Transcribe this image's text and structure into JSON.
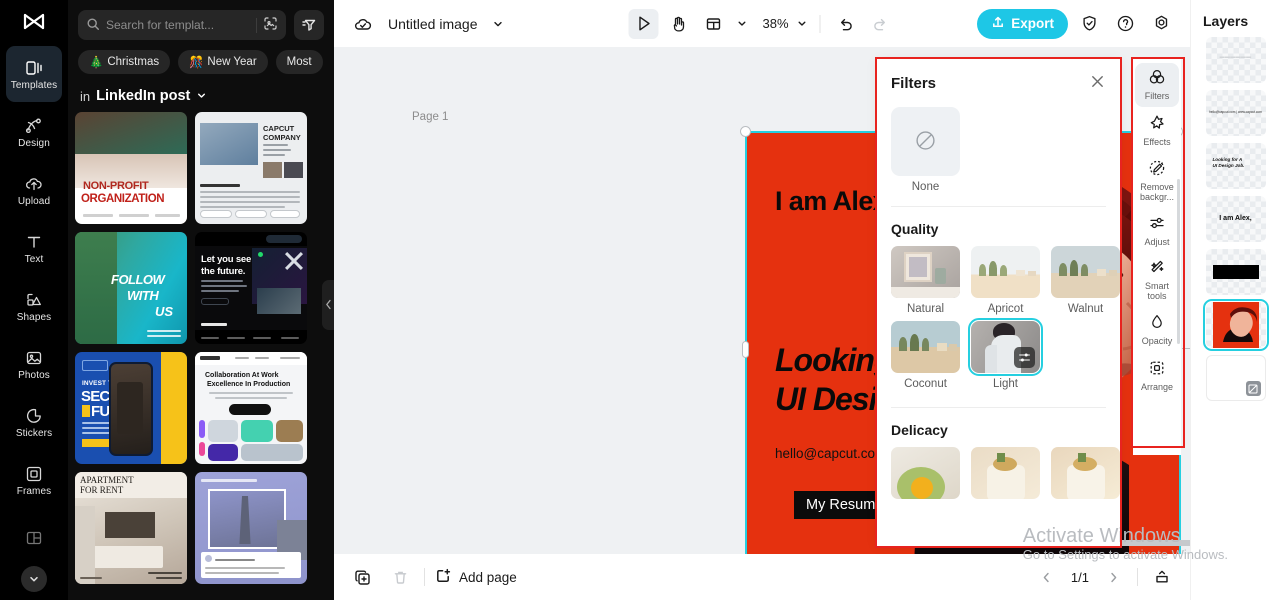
{
  "app": {
    "name": "CapCut",
    "logo_icon": "capcut-logo-icon"
  },
  "left_rail": {
    "items": [
      {
        "label": "Templates",
        "icon": "templates-icon",
        "active": true
      },
      {
        "label": "Design",
        "icon": "design-icon",
        "active": false
      },
      {
        "label": "Upload",
        "icon": "upload-cloud-icon",
        "active": false
      },
      {
        "label": "Text",
        "icon": "text-icon",
        "active": false
      },
      {
        "label": "Shapes",
        "icon": "shapes-icon",
        "active": false
      },
      {
        "label": "Photos",
        "icon": "photos-icon",
        "active": false
      },
      {
        "label": "Stickers",
        "icon": "stickers-icon",
        "active": false
      },
      {
        "label": "Frames",
        "icon": "frames-icon",
        "active": false
      }
    ],
    "more_icon": "chevron-down-icon"
  },
  "template_panel": {
    "search": {
      "placeholder": "Search for templat...",
      "search_icon": "search-icon",
      "image_search_icon": "image-search-icon"
    },
    "filter_icon": "filter-sort-icon",
    "chips": [
      {
        "label": "Christmas",
        "emoji": "🎄"
      },
      {
        "label": "New Year",
        "emoji": "🎊"
      },
      {
        "label": "Most",
        "emoji": ""
      }
    ],
    "category_prefix": "in",
    "category_name": "LinkedIn post",
    "category_caret_icon": "chevron-down-icon",
    "collapse_icon": "chevron-left-icon",
    "templates": [
      {
        "name": "non-profit-organization",
        "title_line1": "NON-PROFIT",
        "title_line2": "ORGANIZATION"
      },
      {
        "name": "capcut-company",
        "title_line1": "CAPCUT",
        "title_line2": "COMPANY"
      },
      {
        "name": "follow-with-us",
        "title_line1": "FOLLOW",
        "title_line2": "WITH",
        "title_line3": "US"
      },
      {
        "name": "let-you-see-the-future",
        "title_line1": "Let you see",
        "title_line2": "the future."
      },
      {
        "name": "secure-future",
        "title_line1": "INVEST TODAY!",
        "title_line2": "SECURE",
        "title_line3": "FUTURE"
      },
      {
        "name": "collaboration-at-work",
        "title_line1": "Collaboration At Work",
        "title_line2": "Excellence In Production"
      },
      {
        "name": "apartment-for-rent",
        "title_line1": "APARTMENT",
        "title_line2": "FOR RENT"
      },
      {
        "name": "travel-post",
        "title_line1": "",
        "title_line2": ""
      }
    ]
  },
  "topbar": {
    "cloud_icon": "cloud-saved-icon",
    "doc_title": "Untitled image",
    "title_caret_icon": "chevron-down-icon",
    "tools": [
      {
        "name": "select-tool",
        "icon": "cursor-arrow-icon",
        "active": true
      },
      {
        "name": "hand-tool",
        "icon": "hand-icon",
        "active": false
      },
      {
        "name": "layout-tool",
        "icon": "layout-icon",
        "active": false
      }
    ],
    "layout_caret_icon": "chevron-down-icon",
    "zoom": "38%",
    "zoom_caret_icon": "chevron-down-icon",
    "undo_icon": "undo-icon",
    "redo_icon": "redo-icon",
    "export_label": "Export",
    "export_icon": "export-upload-icon",
    "export_color": "#1ec7e6",
    "shield_icon": "shield-icon",
    "help_icon": "help-circle-icon",
    "settings_icon": "gear-icon"
  },
  "canvas": {
    "page_label": "Page 1",
    "float_toolbar": [
      {
        "name": "crop-button",
        "icon": "crop-icon"
      },
      {
        "name": "replace-button",
        "icon": "replace-shapes-icon"
      },
      {
        "name": "duplicate-button",
        "icon": "duplicate-icon"
      },
      {
        "name": "more-button",
        "icon": "more-dots-icon"
      }
    ],
    "top_right": [
      {
        "name": "image-layer-button",
        "icon": "image-stack-icon"
      },
      {
        "name": "page-more-button",
        "icon": "more-dots-icon"
      }
    ],
    "rotate_icon": "rotate-icon",
    "artwork": {
      "background_color": "#e5310f",
      "heading": "I am Alex,",
      "subheading_line1": "Looking for A",
      "subheading_line2": "UI Design Job.",
      "contact": "hello@capcut.com | www.capcut.com",
      "button_label": "My Resume"
    }
  },
  "filters_panel": {
    "title": "Filters",
    "close_icon": "close-icon",
    "none": {
      "label": "None",
      "icon": "no-filter-icon"
    },
    "sections": [
      {
        "title": "Quality",
        "items": [
          {
            "label": "Natural",
            "selected": false,
            "c1": "#d9d2cc",
            "c2": "#b9b2ad"
          },
          {
            "label": "Apricot",
            "selected": false,
            "c1": "#eef0f1",
            "c2": "#efdfc7"
          },
          {
            "label": "Walnut",
            "selected": false,
            "c1": "#cfd8da",
            "c2": "#e3d4bd"
          },
          {
            "label": "Coconut",
            "selected": false,
            "c1": "#bcd0d4",
            "c2": "#ddc9ab"
          },
          {
            "label": "Light",
            "selected": true,
            "c1": "#b3b0ad",
            "c2": "#8f8d8c"
          }
        ]
      },
      {
        "title": "Delicacy",
        "items": [
          {
            "label": "",
            "selected": false,
            "c1": "#eceae4",
            "c2": "#f0c53a"
          },
          {
            "label": "",
            "selected": false,
            "c1": "#ead9c4",
            "c2": "#f3e7cf"
          },
          {
            "label": "",
            "selected": false,
            "c1": "#e8d6bd",
            "c2": "#f5ead3"
          }
        ]
      }
    ],
    "adjust_badge_icon": "sliders-icon"
  },
  "tool_rail": {
    "items": [
      {
        "label": "Filters",
        "icon": "filters-circles-icon",
        "active": true
      },
      {
        "label": "Effects",
        "icon": "effects-star-icon",
        "active": false
      },
      {
        "label": "Remove backgr...",
        "icon": "remove-background-icon",
        "active": false
      },
      {
        "label": "Adjust",
        "icon": "sliders-icon",
        "active": false
      },
      {
        "label": "Smart tools",
        "icon": "magic-wand-icon",
        "active": false
      },
      {
        "label": "Opacity",
        "icon": "opacity-drop-icon",
        "active": false
      },
      {
        "label": "Arrange",
        "icon": "arrange-icon",
        "active": false
      }
    ]
  },
  "layers_panel": {
    "title": "Layers",
    "items": [
      {
        "name": "layer-text-faded",
        "kind": "text-faint",
        "label": "",
        "selected": false
      },
      {
        "name": "layer-contact-text",
        "kind": "text-small",
        "label": "hello@capcut.com | www.capcut.com",
        "selected": false
      },
      {
        "name": "layer-subheading",
        "kind": "text-italic",
        "label": "Looking for A UI Design Job.",
        "selected": false
      },
      {
        "name": "layer-heading",
        "kind": "text-bold",
        "label": "I am Alex,",
        "selected": false
      },
      {
        "name": "layer-button-bar",
        "kind": "black-bar",
        "label": "",
        "selected": false
      },
      {
        "name": "layer-photo",
        "kind": "photo",
        "label": "",
        "selected": true
      },
      {
        "name": "layer-background",
        "kind": "blank",
        "label": "",
        "selected": false
      }
    ],
    "blank_badge_icon": "no-fill-icon"
  },
  "bottombar": {
    "duplicate_page_icon": "duplicate-page-icon",
    "delete_page_icon": "trash-icon",
    "add_page_label": "Add page",
    "add_page_icon": "add-page-icon",
    "prev_icon": "chevron-left-icon",
    "page_indicator": "1/1",
    "next_icon": "chevron-right-icon",
    "present_icon": "present-icon"
  },
  "watermark": {
    "line1": "Activate Windows",
    "line2": "Go to Settings to activate Windows."
  },
  "annotations": {
    "color": "#e8231f",
    "boxes": [
      {
        "name": "filters-panel-highlight"
      },
      {
        "name": "tool-rail-highlight"
      }
    ]
  }
}
